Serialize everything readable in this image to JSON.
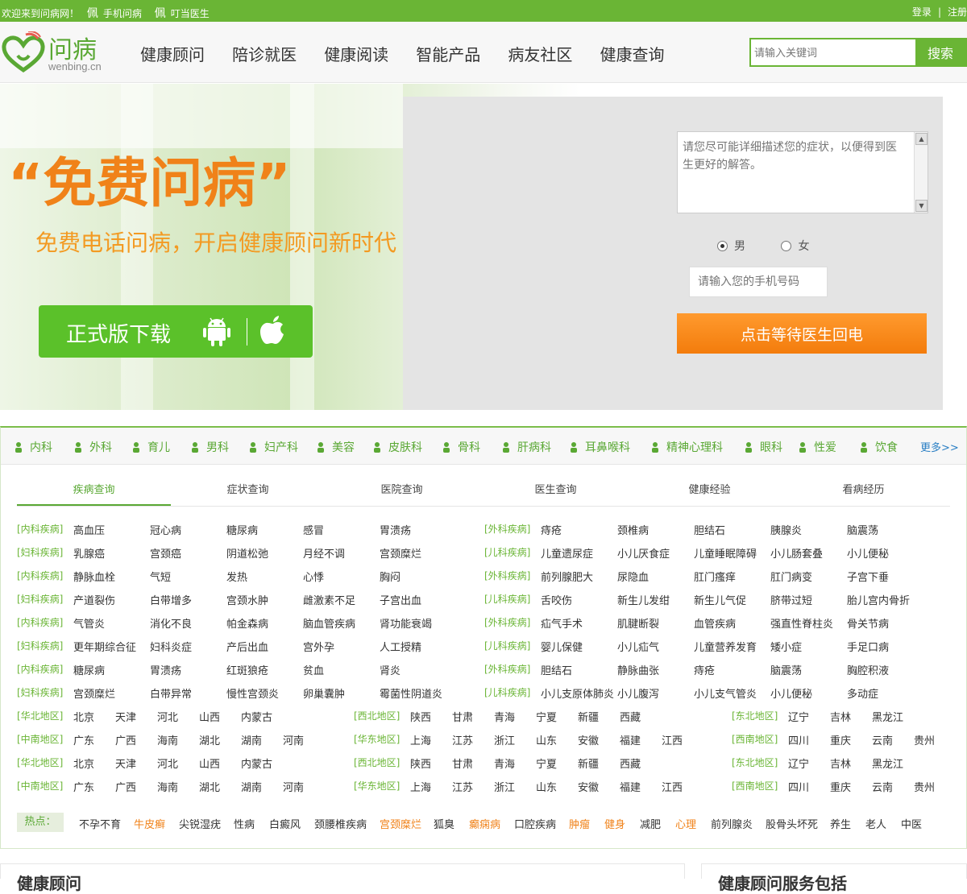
{
  "topbar": {
    "welcome": "欢迎来到问病网！",
    "mobile": "手机问病",
    "doctor": "叮当医生",
    "login": "登录",
    "separator": "|",
    "register": "注册"
  },
  "logo": {
    "cn": "问病",
    "en": "wenbing.cn"
  },
  "nav": [
    "健康顾问",
    "陪诊就医",
    "健康阅读",
    "智能产品",
    "病友社区",
    "健康查询"
  ],
  "search": {
    "placeholder": "请输入关键词",
    "button": "搜索"
  },
  "banner": {
    "slogan": "“免费问病”",
    "subtitle": "免费电话问病，开启健康顾问新时代",
    "download": "正式版下载"
  },
  "form": {
    "placeholder": "请您尽可能详细描述您的症状，以便得到医生更好的解答。",
    "male": "男",
    "female": "女",
    "selected_gender": "male",
    "phone_placeholder": "请输入您的手机号码",
    "submit": "点击等待医生回电"
  },
  "departments": [
    "内科",
    "外科",
    "育儿",
    "男科",
    "妇产科",
    "美容",
    "皮肤科",
    "骨科",
    "肝病科",
    "耳鼻喉科",
    "精神心理科",
    "眼科",
    "性爱",
    "饮食"
  ],
  "more": "更多>>",
  "tabs": [
    "疾病查询",
    "症状查询",
    "医院查询",
    "医生查询",
    "健康经验",
    "看病经历"
  ],
  "active_tab": 0,
  "disease_rows": [
    {
      "c1": "[内科疾病]",
      "i1": [
        "高血压",
        "冠心病",
        "糖尿病",
        "感冒",
        "胃溃疡"
      ],
      "c2": "[外科疾病]",
      "i2": [
        "痔疮",
        "颈椎病",
        "胆结石",
        "胰腺炎",
        "脑震荡"
      ]
    },
    {
      "c1": "[妇科疾病]",
      "i1": [
        "乳腺癌",
        "宫颈癌",
        "阴道松弛",
        "月经不调",
        "宫颈糜烂"
      ],
      "c2": "[儿科疾病]",
      "i2": [
        "儿童遗尿症",
        "小儿厌食症",
        "儿童睡眠障碍",
        "小儿肠套叠",
        "小儿便秘"
      ]
    },
    {
      "c1": "[内科疾病]",
      "i1": [
        "静脉血栓",
        "气短",
        "发热",
        "心悸",
        "胸闷"
      ],
      "c2": "[外科疾病]",
      "i2": [
        "前列腺肥大",
        "尿隐血",
        "肛门瘙痒",
        "肛门病变",
        "子宫下垂"
      ]
    },
    {
      "c1": "[妇科疾病]",
      "i1": [
        "产道裂伤",
        "白带增多",
        "宫颈水肿",
        "雌激素不足",
        "子宫出血"
      ],
      "c2": "[儿科疾病]",
      "i2": [
        "舌咬伤",
        "新生儿发绀",
        "新生儿气促",
        "脐带过短",
        "胎儿宫内骨折"
      ]
    },
    {
      "c1": "[内科疾病]",
      "i1": [
        "气管炎",
        "消化不良",
        "帕金森病",
        "脑血管疾病",
        "肾功能衰竭"
      ],
      "c2": "[外科疾病]",
      "i2": [
        "疝气手术",
        "肌腱断裂",
        "血管疾病",
        "强直性脊柱炎",
        "骨关节病"
      ]
    },
    {
      "c1": "[妇科疾病]",
      "i1": [
        "更年期综合征",
        "妇科炎症",
        "产后出血",
        "宫外孕",
        "人工授精"
      ],
      "c2": "[儿科疾病]",
      "i2": [
        "婴儿保健",
        "小儿疝气",
        "儿童营养发育",
        "矮小症",
        "手足口病"
      ]
    },
    {
      "c1": "[内科疾病]",
      "i1": [
        "糖尿病",
        "胃溃疡",
        "红斑狼疮",
        "贫血",
        "肾炎"
      ],
      "c2": "[外科疾病]",
      "i2": [
        "胆结石",
        "静脉曲张",
        "痔疮",
        "脑震荡",
        "胸腔积液"
      ]
    },
    {
      "c1": "[妇科疾病]",
      "i1": [
        "宫颈糜烂",
        "白带异常",
        "慢性宫颈炎",
        "卵巢囊肿",
        "霉菌性阴道炎"
      ],
      "c2": "[儿科疾病]",
      "i2": [
        "小儿支原体肺炎",
        "小儿腹泻",
        "小儿支气管炎",
        "小儿便秘",
        "多动症"
      ]
    }
  ],
  "region_rows": [
    {
      "c1": "[华北地区]",
      "i1": [
        "北京",
        "天津",
        "河北",
        "山西",
        "内蒙古"
      ],
      "c2": "[西北地区]",
      "i2": [
        "陕西",
        "甘肃",
        "青海",
        "宁夏",
        "新疆",
        "西藏"
      ],
      "c3": "[东北地区]",
      "i3": [
        "辽宁",
        "吉林",
        "黑龙江"
      ]
    },
    {
      "c1": "[中南地区]",
      "i1": [
        "广东",
        "广西",
        "海南",
        "湖北",
        "湖南",
        "河南"
      ],
      "c2": "[华东地区]",
      "i2": [
        "上海",
        "江苏",
        "浙江",
        "山东",
        "安徽",
        "福建",
        "江西"
      ],
      "c3": "[西南地区]",
      "i3": [
        "四川",
        "重庆",
        "云南",
        "贵州"
      ]
    },
    {
      "c1": "[华北地区]",
      "i1": [
        "北京",
        "天津",
        "河北",
        "山西",
        "内蒙古"
      ],
      "c2": "[西北地区]",
      "i2": [
        "陕西",
        "甘肃",
        "青海",
        "宁夏",
        "新疆",
        "西藏"
      ],
      "c3": "[东北地区]",
      "i3": [
        "辽宁",
        "吉林",
        "黑龙江"
      ]
    },
    {
      "c1": "[中南地区]",
      "i1": [
        "广东",
        "广西",
        "海南",
        "湖北",
        "湖南",
        "河南"
      ],
      "c2": "[华东地区]",
      "i2": [
        "上海",
        "江苏",
        "浙江",
        "山东",
        "安徽",
        "福建",
        "江西"
      ],
      "c3": "[西南地区]",
      "i3": [
        "四川",
        "重庆",
        "云南",
        "贵州"
      ]
    }
  ],
  "hot": {
    "label": "热点：",
    "items": [
      {
        "t": "不孕不育",
        "hl": false
      },
      {
        "t": "牛皮癣",
        "hl": true
      },
      {
        "t": "尖锐湿疣",
        "hl": false
      },
      {
        "t": "性病",
        "hl": false
      },
      {
        "t": "白癜风",
        "hl": false
      },
      {
        "t": "颈腰椎疾病",
        "hl": false
      },
      {
        "t": "宫颈糜烂",
        "hl": true
      },
      {
        "t": "狐臭",
        "hl": false
      },
      {
        "t": "癫痫病",
        "hl": true
      },
      {
        "t": "口腔疾病",
        "hl": false
      },
      {
        "t": "肿瘤",
        "hl": true
      },
      {
        "t": "健身",
        "hl": true
      },
      {
        "t": "减肥",
        "hl": false
      },
      {
        "t": "心理",
        "hl": true
      },
      {
        "t": "前列腺炎",
        "hl": false
      },
      {
        "t": "股骨头坏死",
        "hl": false
      },
      {
        "t": "养生",
        "hl": false
      },
      {
        "t": "老人",
        "hl": false
      },
      {
        "t": "中医",
        "hl": false
      }
    ]
  },
  "bottom": {
    "left_title": "健康顾问",
    "right_title": "健康顾问服务包括"
  },
  "colors": {
    "brand_green": "#6ab535",
    "accent_orange": "#f08219"
  }
}
